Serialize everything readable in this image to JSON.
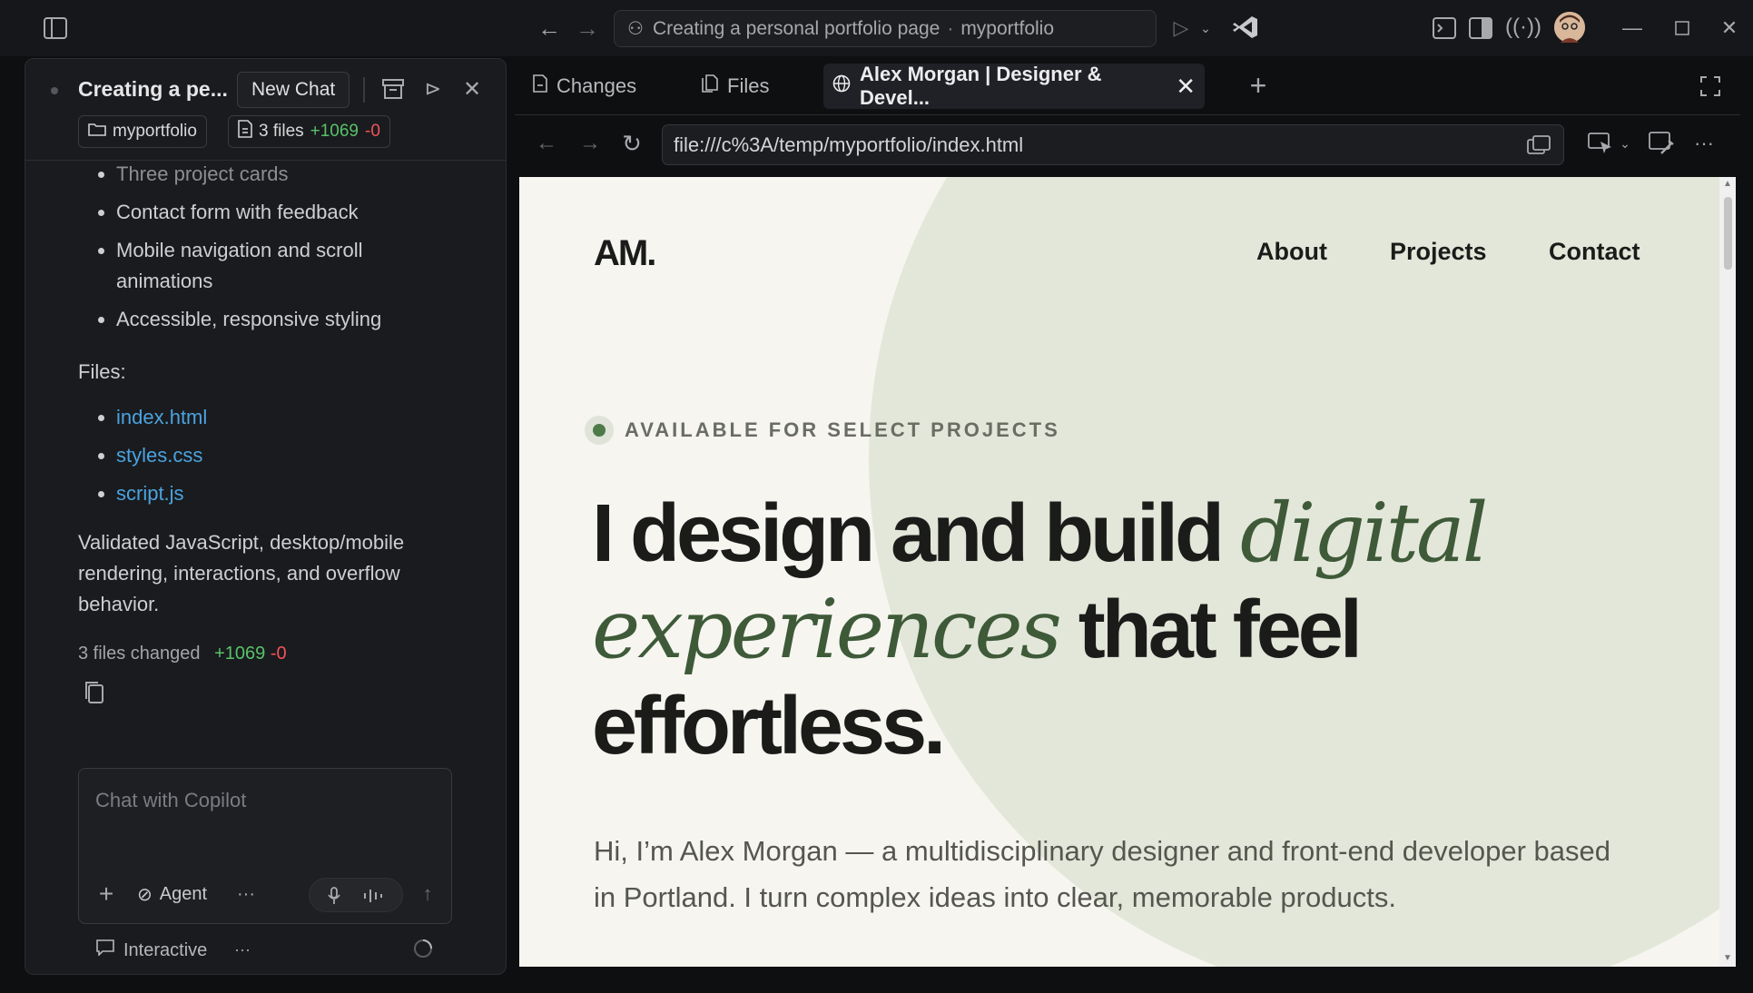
{
  "titlebar": {
    "command_center": "Creating a personal portfolio page",
    "workspace": "myportfolio"
  },
  "chat": {
    "title": "Creating a pe...",
    "new_chat": "New Chat",
    "folder_chip": "myportfolio",
    "files_chip": "3 files",
    "additions": "+1069",
    "deletions": "-0",
    "bullets": [
      "Three project cards",
      "Contact form with feedback",
      "Mobile navigation and scroll animations",
      "Accessible, responsive styling"
    ],
    "files_label": "Files:",
    "files": [
      "index.html",
      "styles.css",
      "script.js"
    ],
    "summary": "Validated JavaScript, desktop/mobile rendering, interactions, and overflow behavior.",
    "changed_label": "3 files changed",
    "composer_placeholder": "Chat with Copilot",
    "mode": "Agent",
    "interactive": "Interactive"
  },
  "tabs": [
    {
      "label": "Changes"
    },
    {
      "label": "Files"
    },
    {
      "label": "Alex Morgan | Designer & Devel..."
    }
  ],
  "browser": {
    "url": "file:///c%3A/temp/myportfolio/index.html"
  },
  "site": {
    "logo": "AM.",
    "nav": [
      "About",
      "Projects",
      "Contact"
    ],
    "badge": "AVAILABLE FOR SELECT PROJECTS",
    "hero_a": "I design and build ",
    "hero_em1": "digital",
    "hero_em2": "experiences",
    "hero_b": " that feel",
    "hero_c": "effortless.",
    "intro": "Hi, I’m Alex Morgan — a multidisciplinary designer and front-end developer based in Portland. I turn complex ideas into clear, memorable products."
  }
}
